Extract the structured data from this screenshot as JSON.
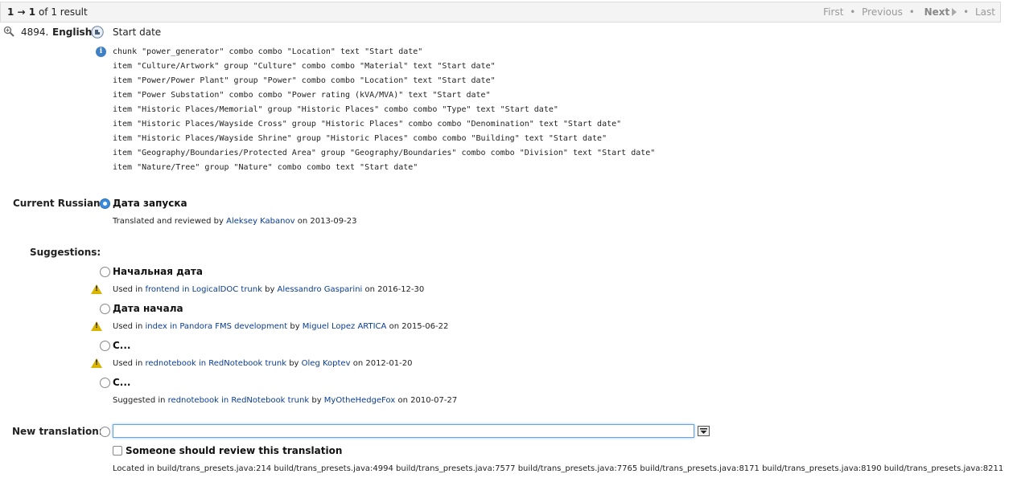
{
  "header": {
    "result_prefix": "1 → 1",
    "result_suffix": "of 1 result",
    "nav": {
      "first": "First",
      "previous": "Previous",
      "next": "Next",
      "last": "Last",
      "sep": "•"
    }
  },
  "message": {
    "number": "4894.",
    "lang_label": "English:",
    "source_text": "Start date",
    "context_lines": [
      "chunk \"power_generator\" combo combo \"Location\" text \"Start date\"",
      "item \"Culture/Artwork\" group \"Culture\" combo combo \"Material\" text \"Start date\"",
      "item \"Power/Power Plant\" group \"Power\" combo combo \"Location\" text \"Start date\"",
      "item \"Power Substation\" combo combo \"Power rating (kVA/MVA)\" text \"Start date\"",
      "item \"Historic Places/Memorial\" group \"Historic Places\" combo combo \"Type\" text \"Start date\"",
      "item \"Historic Places/Wayside Cross\" group \"Historic Places\" combo combo \"Denomination\" text \"Start date\"",
      "item \"Historic Places/Wayside Shrine\" group \"Historic Places\" combo combo \"Building\" text \"Start date\"",
      "item \"Geography/Boundaries/Protected Area\" group \"Geography/Boundaries\" combo combo \"Division\" text \"Start date\"",
      "item \"Nature/Tree\" group \"Nature\" combo combo  text \"Start date\""
    ]
  },
  "current": {
    "label": "Current Russian:",
    "text": "Дата запуска",
    "meta_prefix": "Translated and reviewed by",
    "person": "Aleksey Kabanov",
    "meta_suffix": "on 2013-09-23"
  },
  "suggestions": {
    "label": "Suggestions:",
    "items": [
      {
        "text": "Начальная дата",
        "prefix": "Used in",
        "where": "frontend in LogicalDOC trunk",
        "by": "by",
        "person": "Alessandro Gasparini",
        "date": "on 2016-12-30",
        "warning": true
      },
      {
        "text": "Дата начала",
        "prefix": "Used in",
        "where": "index in Pandora FMS development",
        "by": "by",
        "person": "Miguel Lopez ARTICA",
        "date": "on 2015-06-22",
        "warning": true
      },
      {
        "text": "С...",
        "prefix": "Used in",
        "where": "rednotebook in RedNotebook trunk",
        "by": "by",
        "person": "Oleg Koptev",
        "date": "on 2012-01-20",
        "warning": true
      },
      {
        "text": "С...",
        "prefix": "Suggested in",
        "where": "rednotebook in RedNotebook trunk",
        "by": "by",
        "person": "MyOtheHedgeFox",
        "date": "on 2010-07-27",
        "warning": false
      }
    ]
  },
  "new_translation": {
    "label": "New translation:",
    "value": "",
    "review_label": "Someone should review this translation",
    "located": "Located in build/trans_presets.java:214 build/trans_presets.java:4994 build/trans_presets.java:7577 build/trans_presets.java:7765 build/trans_presets.java:8171 build/trans_presets.java:8190 build/trans_presets.java:8211"
  }
}
